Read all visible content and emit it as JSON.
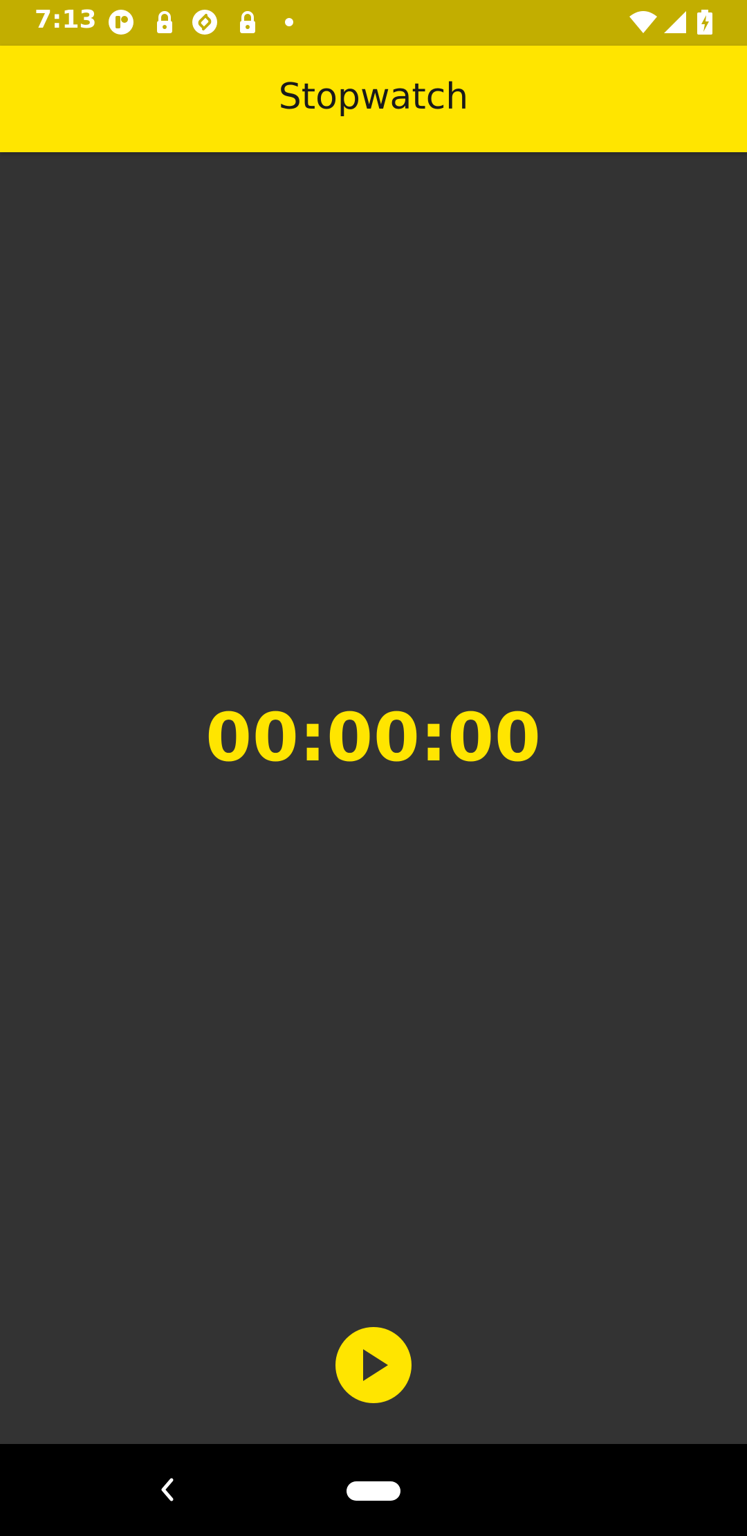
{
  "status_bar": {
    "time": "7:13",
    "icons": [
      "app-notification-icon",
      "lock-icon",
      "shazam-icon",
      "lock-icon",
      "dot-icon",
      "wifi-icon",
      "signal-icon",
      "battery-charging-icon"
    ]
  },
  "app_bar": {
    "title": "Stopwatch"
  },
  "timer": {
    "display": "00:00:00"
  },
  "controls": {
    "play_icon": "play-icon"
  },
  "navigation": {
    "back_icon": "back-icon",
    "home_icon": "home-pill-icon"
  },
  "colors": {
    "accent": "#FFE500",
    "status_bar": "#C2AE00",
    "background": "#333333",
    "nav_bar": "#000000"
  }
}
